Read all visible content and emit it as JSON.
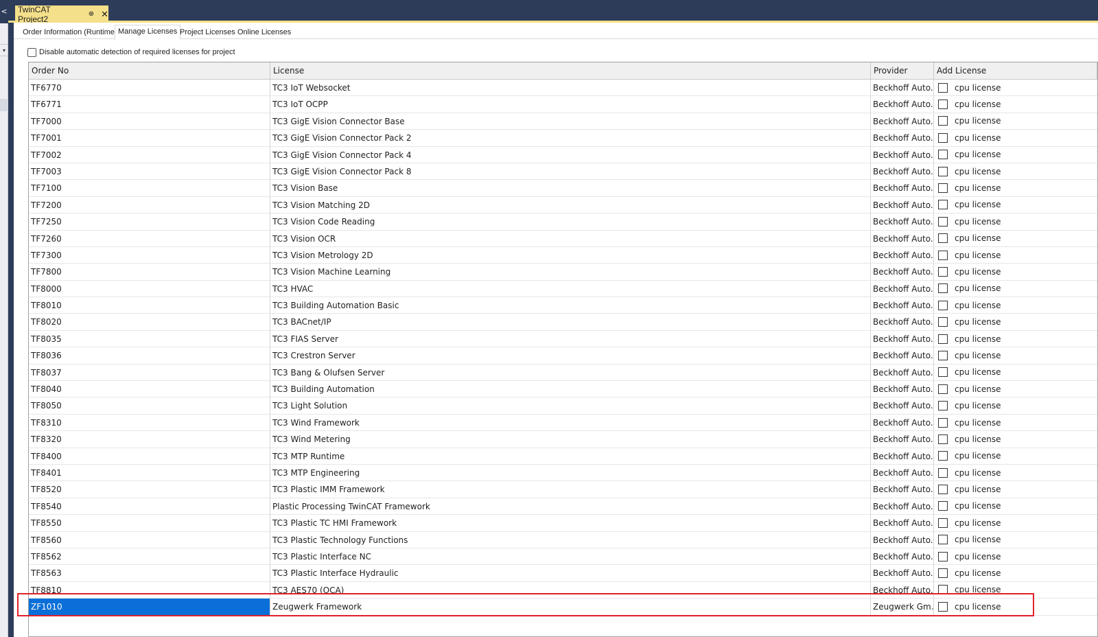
{
  "window": {
    "document_tab": {
      "title": "TwinCAT Project2",
      "pin_icon": "⊕",
      "close_icon": "✕"
    },
    "left_strip_icons": {
      "back": "<",
      "dropdown": "▾"
    }
  },
  "tabs": [
    {
      "label": "Order Information (Runtime)",
      "active": false
    },
    {
      "label": "Manage Licenses",
      "active": true
    },
    {
      "label": "Project Licenses",
      "active": false
    },
    {
      "label": "Online Licenses",
      "active": false
    }
  ],
  "options": {
    "disable_auto_detect_label": "Disable automatic detection of required licenses for project",
    "disable_auto_detect_checked": false
  },
  "grid": {
    "columns": [
      "Order No",
      "License",
      "Provider",
      "Add License"
    ],
    "rows": [
      {
        "order_no": "TF6770",
        "license": "TC3 IoT Websocket",
        "provider": "Beckhoff Auto...",
        "add_license": "cpu license"
      },
      {
        "order_no": "TF6771",
        "license": "TC3 IoT OCPP",
        "provider": "Beckhoff Auto...",
        "add_license": "cpu license"
      },
      {
        "order_no": "TF7000",
        "license": "TC3 GigE Vision Connector Base",
        "provider": "Beckhoff Auto...",
        "add_license": "cpu license"
      },
      {
        "order_no": "TF7001",
        "license": "TC3 GigE Vision Connector Pack 2",
        "provider": "Beckhoff Auto...",
        "add_license": "cpu license"
      },
      {
        "order_no": "TF7002",
        "license": "TC3 GigE Vision Connector Pack 4",
        "provider": "Beckhoff Auto...",
        "add_license": "cpu license"
      },
      {
        "order_no": "TF7003",
        "license": "TC3 GigE Vision Connector Pack 8",
        "provider": "Beckhoff Auto...",
        "add_license": "cpu license"
      },
      {
        "order_no": "TF7100",
        "license": "TC3 Vision Base",
        "provider": "Beckhoff Auto...",
        "add_license": "cpu license"
      },
      {
        "order_no": "TF7200",
        "license": "TC3 Vision Matching 2D",
        "provider": "Beckhoff Auto...",
        "add_license": "cpu license"
      },
      {
        "order_no": "TF7250",
        "license": "TC3 Vision Code Reading",
        "provider": "Beckhoff Auto...",
        "add_license": "cpu license"
      },
      {
        "order_no": "TF7260",
        "license": "TC3 Vision OCR",
        "provider": "Beckhoff Auto...",
        "add_license": "cpu license"
      },
      {
        "order_no": "TF7300",
        "license": "TC3 Vision Metrology 2D",
        "provider": "Beckhoff Auto...",
        "add_license": "cpu license"
      },
      {
        "order_no": "TF7800",
        "license": "TC3 Vision Machine Learning",
        "provider": "Beckhoff Auto...",
        "add_license": "cpu license"
      },
      {
        "order_no": "TF8000",
        "license": "TC3 HVAC",
        "provider": "Beckhoff Auto...",
        "add_license": "cpu license"
      },
      {
        "order_no": "TF8010",
        "license": "TC3 Building Automation Basic",
        "provider": "Beckhoff Auto...",
        "add_license": "cpu license"
      },
      {
        "order_no": "TF8020",
        "license": "TC3 BACnet/IP",
        "provider": "Beckhoff Auto...",
        "add_license": "cpu license"
      },
      {
        "order_no": "TF8035",
        "license": "TC3 FIAS Server",
        "provider": "Beckhoff Auto...",
        "add_license": "cpu license"
      },
      {
        "order_no": "TF8036",
        "license": "TC3 Crestron Server",
        "provider": "Beckhoff Auto...",
        "add_license": "cpu license"
      },
      {
        "order_no": "TF8037",
        "license": "TC3 Bang & Olufsen Server",
        "provider": "Beckhoff Auto...",
        "add_license": "cpu license"
      },
      {
        "order_no": "TF8040",
        "license": "TC3 Building Automation",
        "provider": "Beckhoff Auto...",
        "add_license": "cpu license"
      },
      {
        "order_no": "TF8050",
        "license": "TC3 Light Solution",
        "provider": "Beckhoff Auto...",
        "add_license": "cpu license"
      },
      {
        "order_no": "TF8310",
        "license": "TC3 Wind Framework",
        "provider": "Beckhoff Auto...",
        "add_license": "cpu license"
      },
      {
        "order_no": "TF8320",
        "license": "TC3 Wind Metering",
        "provider": "Beckhoff Auto...",
        "add_license": "cpu license"
      },
      {
        "order_no": "TF8400",
        "license": "TC3 MTP Runtime",
        "provider": "Beckhoff Auto...",
        "add_license": "cpu license"
      },
      {
        "order_no": "TF8401",
        "license": "TC3 MTP Engineering",
        "provider": "Beckhoff Auto...",
        "add_license": "cpu license"
      },
      {
        "order_no": "TF8520",
        "license": "TC3 Plastic IMM Framework",
        "provider": "Beckhoff Auto...",
        "add_license": "cpu license"
      },
      {
        "order_no": "TF8540",
        "license": "Plastic Processing TwinCAT Framework",
        "provider": "Beckhoff Auto...",
        "add_license": "cpu license"
      },
      {
        "order_no": "TF8550",
        "license": "TC3 Plastic TC HMI Framework",
        "provider": "Beckhoff Auto...",
        "add_license": "cpu license"
      },
      {
        "order_no": "TF8560",
        "license": "TC3 Plastic Technology Functions",
        "provider": "Beckhoff Auto...",
        "add_license": "cpu license"
      },
      {
        "order_no": "TF8562",
        "license": "TC3 Plastic Interface NC",
        "provider": "Beckhoff Auto...",
        "add_license": "cpu license"
      },
      {
        "order_no": "TF8563",
        "license": "TC3 Plastic Interface Hydraulic",
        "provider": "Beckhoff Auto...",
        "add_license": "cpu license"
      },
      {
        "order_no": "TF8810",
        "license": "TC3 AES70 (OCA)",
        "provider": "Beckhoff Auto...",
        "add_license": "cpu license"
      },
      {
        "order_no": "ZF1010",
        "license": "Zeugwerk Framework",
        "provider": "Zeugwerk Gm...",
        "add_license": "cpu license",
        "selected": true
      }
    ]
  },
  "colors": {
    "title_bar": "#2d3c59",
    "doc_tab": "#f4e08a",
    "selection": "#0a6fd8",
    "highlight_box": "#e0202a"
  }
}
